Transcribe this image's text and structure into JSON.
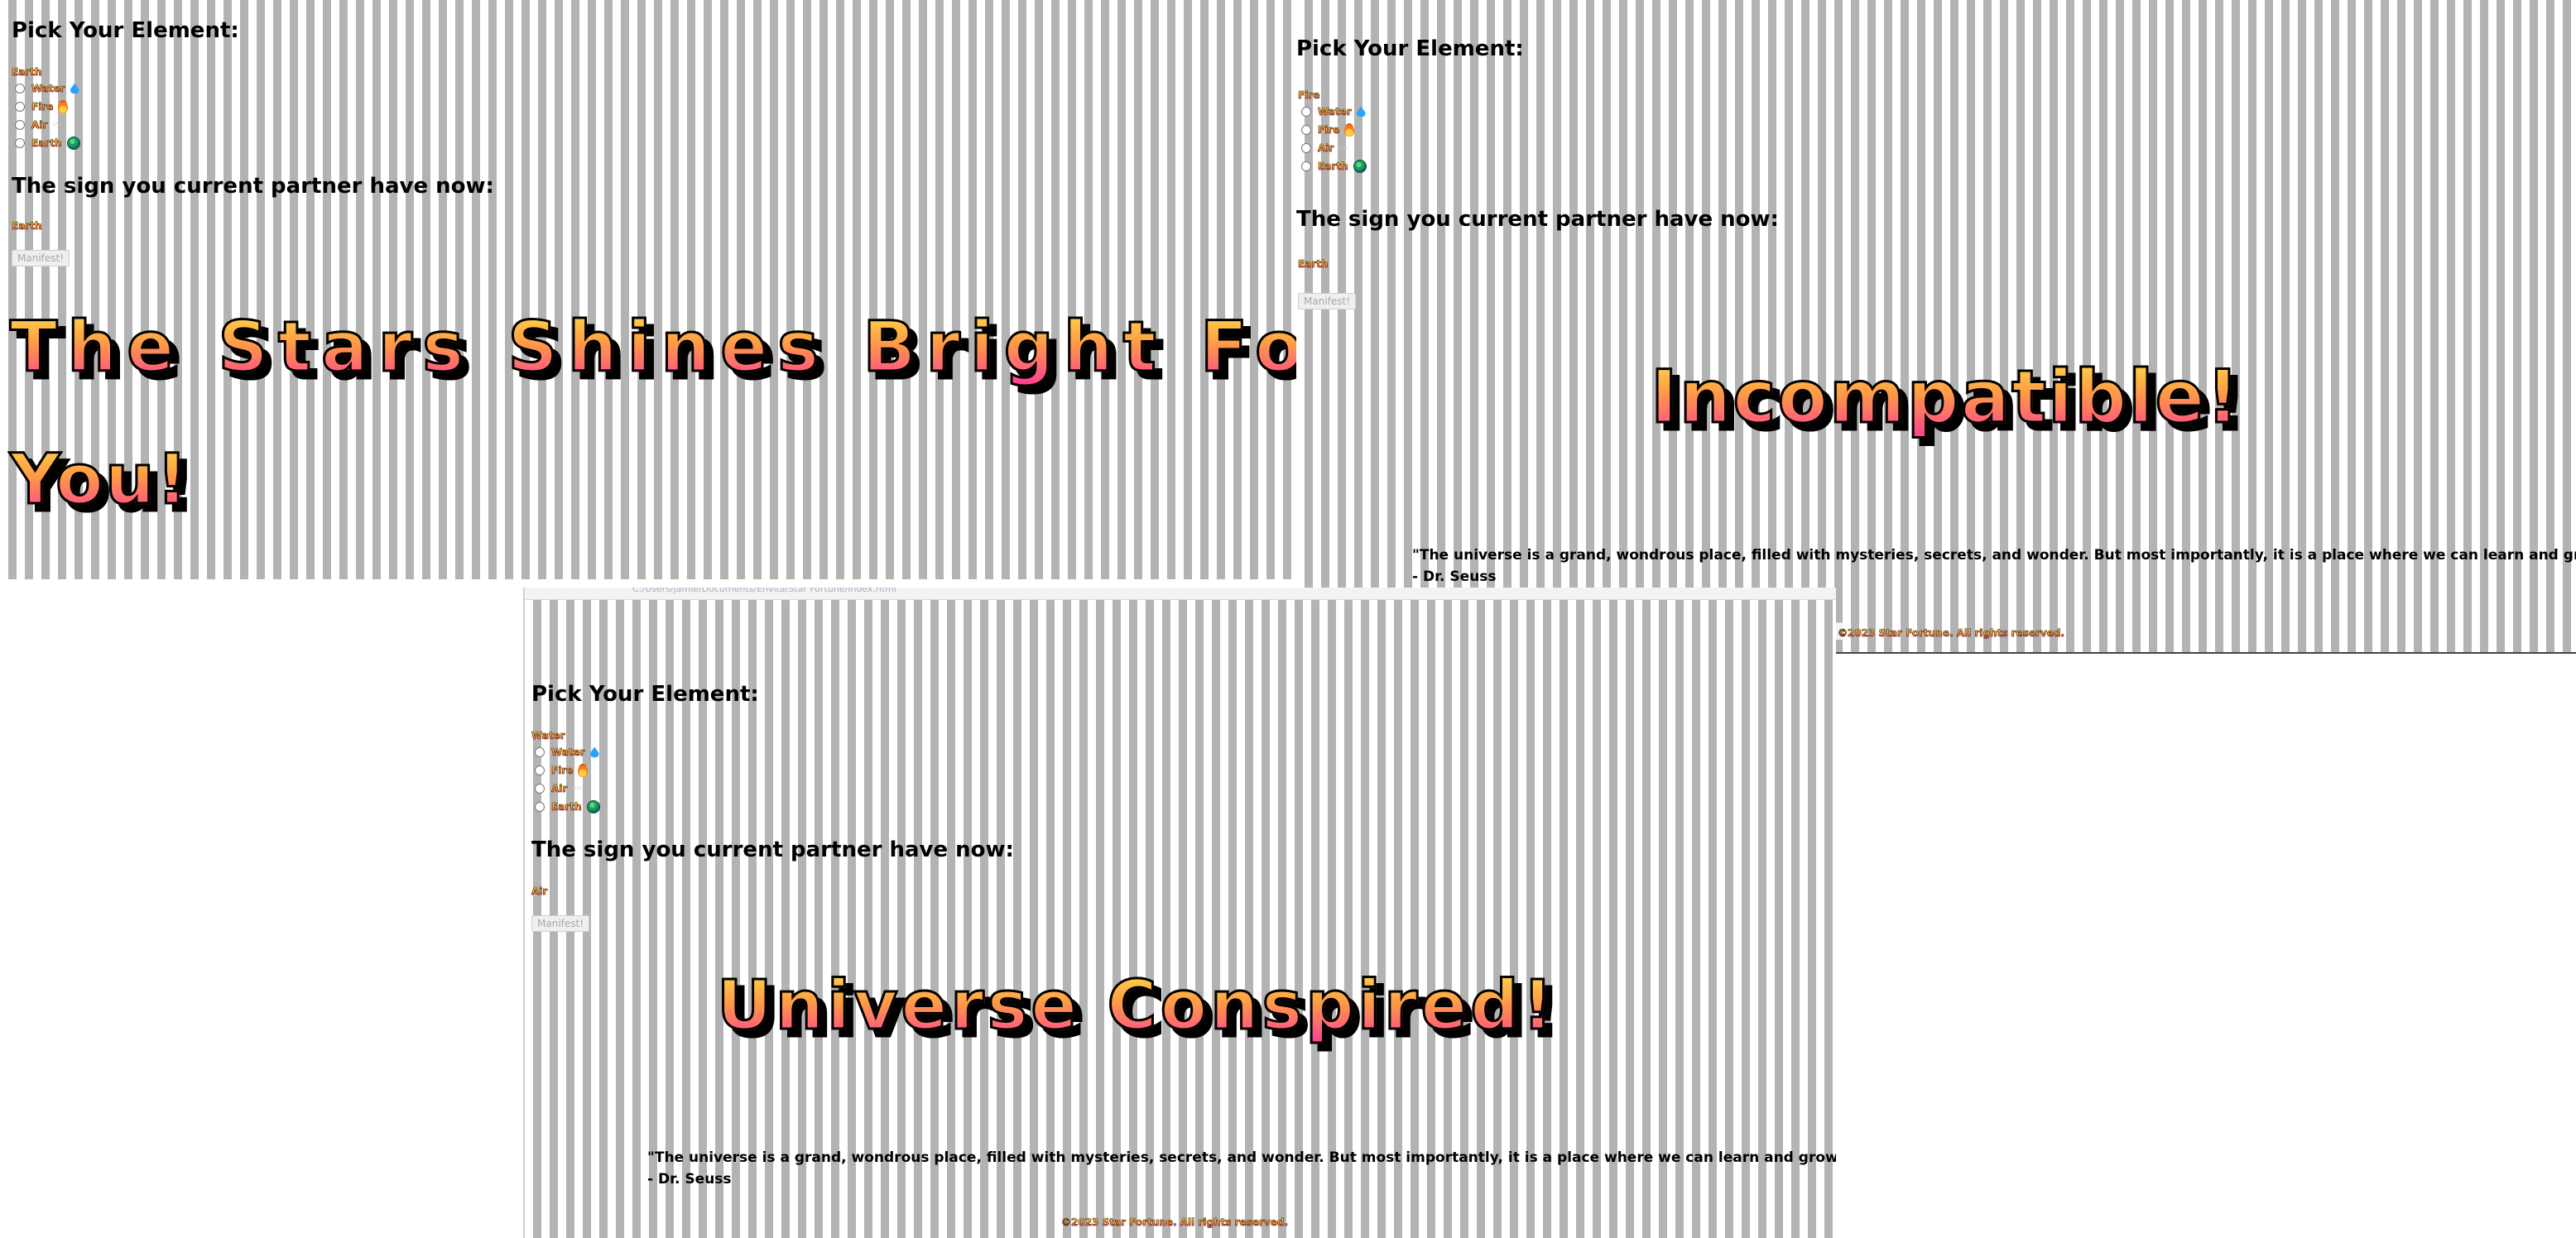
{
  "shared": {
    "heading_pick": "Pick Your Element:",
    "heading_partner": "The sign you current partner have now:",
    "manifest_label": "Manifest!",
    "options": [
      {
        "label": "Water",
        "icon": "water-drop-icon"
      },
      {
        "label": "Fire",
        "icon": "fire-icon"
      },
      {
        "label": "Air",
        "icon": "wind-icon"
      },
      {
        "label": "Earth",
        "icon": "earth-globe-icon"
      }
    ],
    "quote_line1": "\"The universe is a grand, wondrous place, filled with mysteries, secrets, and wonder. But most importantly, it is a place where we can learn and grow.\"",
    "quote_line2": "- Dr. Seuss",
    "footer": "©2023 Star Fortune. All rights reserved."
  },
  "panels": [
    {
      "selected_element": "Earth",
      "partner_sign": "Earth",
      "result_line1": "The Stars Shines Bright For",
      "result_line2": "You!"
    },
    {
      "selected_element": "Fire",
      "partner_sign": "Earth",
      "result": "Incompatible!"
    },
    {
      "selected_element": "Water",
      "partner_sign": "Air",
      "result": "Universe Conspired!",
      "address": "C:/Users/jamie/Documents/Envita/Star Fortune/index.html"
    }
  ]
}
